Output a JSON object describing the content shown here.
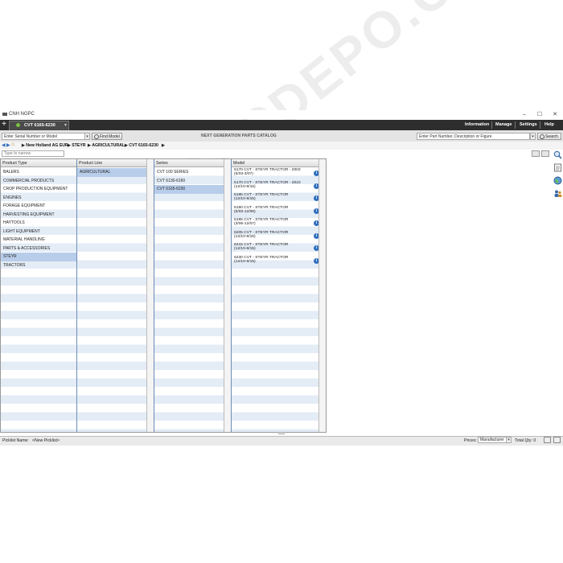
{
  "window": {
    "title": "CNH NGPC",
    "minimize": "–",
    "maximize": "☐",
    "close": "✕"
  },
  "toolbar": {
    "new_tab": "+",
    "tab_label": "CVT 6165-6230",
    "tab_close": "▾",
    "menu": [
      "Information",
      "Manage",
      "Settings",
      "Help"
    ]
  },
  "search": {
    "serial_placeholder": "Enter Serial Number or Model",
    "find_model_label": "Find Model",
    "catalog_title": "NEXT GENERATION PARTS CATALOG",
    "part_placeholder": "Enter Part Number, Description or Figure",
    "search_label": "Search"
  },
  "breadcrumb": [
    "New Holland AG EUR",
    "STEYR",
    "AGRICULTURAL",
    "CVT 6165-6230"
  ],
  "filter": {
    "placeholder": "Type to narrow"
  },
  "columns": {
    "product_type": {
      "header": "Product Type",
      "items": [
        "BALERS",
        "COMMERCIAL PRODUCTS",
        "CROP PRODUCTION EQUIPMENT",
        "ENGINES",
        "FORAGE EQUIPMENT",
        "HARVESTING EQUIPMENT",
        "HAYTOOLS",
        "LIGHT EQUIPMENT",
        "MATERIAL HANDLING",
        "PARTS & ACCESSORIES",
        "STEYR",
        "TRACTORS"
      ],
      "selected": "STEYR"
    },
    "product_line": {
      "header": "Product Line",
      "items": [
        "AGRICULTURAL"
      ],
      "selected": "AGRICULTURAL"
    },
    "series": {
      "header": "Series",
      "items": [
        "CVT 100 SERIES",
        "CVT 6130-6160",
        "CVT 6165-6230"
      ],
      "selected": "CVT 6165-6230"
    },
    "model": {
      "header": "Model",
      "items": [
        {
          "line1": "6170 CVT - STEYR TRACTOR - 2003",
          "line2": "(5/03-3/07)"
        },
        {
          "line1": "6170 CVT - STEYR TRACTOR - 2010",
          "line2": "(12/10-8/15)"
        },
        {
          "line1": "6185 CVT - STEYR TRACTOR",
          "line2": "(12/10-8/15)"
        },
        {
          "line1": "6190 CVT - STEYR TRACTOR",
          "line2": "(5/03-12/06)"
        },
        {
          "line1": "6195 CVT - STEYR TRACTOR",
          "line2": "(3/06-12/07)"
        },
        {
          "line1": "6205 CVT - STEYR TRACTOR",
          "line2": "(12/10-8/15)"
        },
        {
          "line1": "6215 CVT - STEYR TRACTOR",
          "line2": "(12/10-8/15)"
        },
        {
          "line1": "6230 CVT - STEYR TRACTOR",
          "line2": "(12/10-8/15)"
        }
      ]
    }
  },
  "bottom": {
    "picklist_label": "Picklist Name:",
    "picklist_value": "<New Picklist>",
    "prices_label": "Prices:",
    "prices_value": "Manufacturer",
    "total_label": "Total Qty: 0"
  },
  "watermark": "WWW.EPCDEPO.COM",
  "colors": {
    "accent": "#2f6fbf",
    "selection": "#b8cdea",
    "dark_bar": "#2e2e2e"
  }
}
